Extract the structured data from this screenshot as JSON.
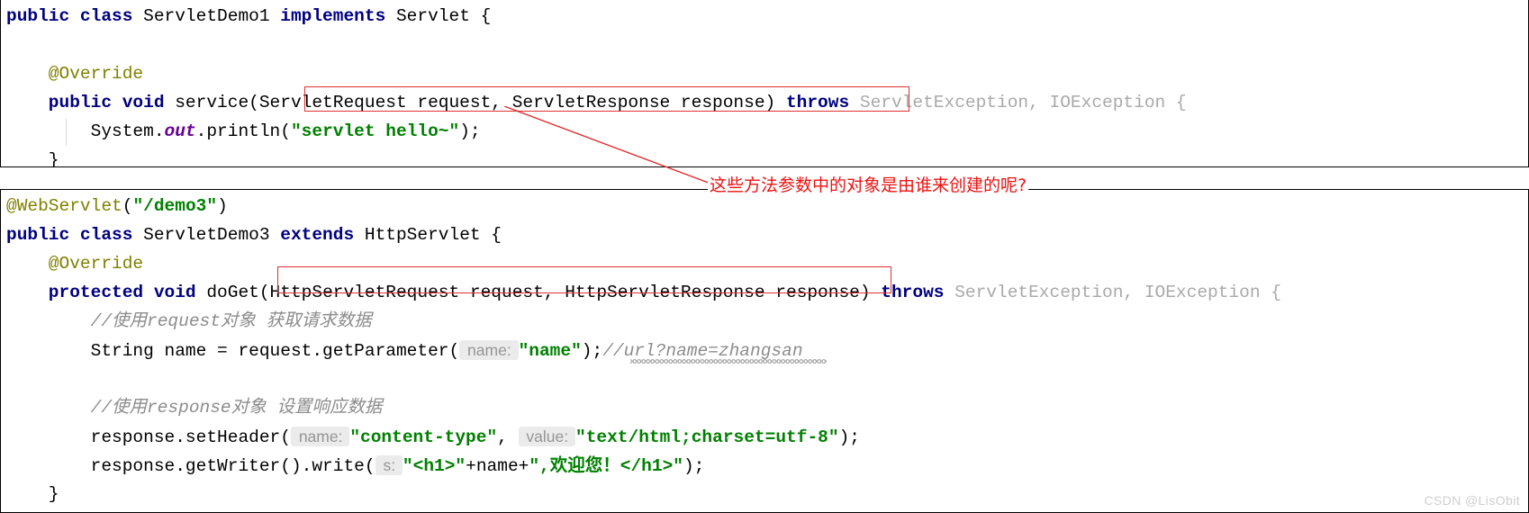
{
  "top_block": {
    "lines": [
      [
        {
          "t": "public class ",
          "c": "kw"
        },
        {
          "t": "ServletDemo1 ",
          "c": "plain"
        },
        {
          "t": "implements ",
          "c": "kw"
        },
        {
          "t": "Servlet {",
          "c": "plain"
        }
      ],
      [],
      [
        {
          "t": "    @Override",
          "c": "anno"
        }
      ],
      [
        {
          "t": "    public void ",
          "c": "kw"
        },
        {
          "t": "service(ServletRequest request, ServletResponse response) ",
          "c": "plain"
        },
        {
          "t": "throws ",
          "c": "kw"
        },
        {
          "t": "ServletException, IOException {",
          "c": "grey"
        }
      ],
      [
        {
          "t": "        System.",
          "c": "plain"
        },
        {
          "t": "out",
          "c": "field"
        },
        {
          "t": ".println(",
          "c": "plain"
        },
        {
          "t": "\"servlet hello~\"",
          "c": "str"
        },
        {
          "t": ");",
          "c": "plain"
        }
      ],
      [
        {
          "t": "    }",
          "c": "plain"
        }
      ]
    ]
  },
  "bottom_block": {
    "lines": [
      [
        {
          "t": "@WebServlet",
          "c": "anno"
        },
        {
          "t": "(",
          "c": "plain"
        },
        {
          "t": "\"/demo3\"",
          "c": "str"
        },
        {
          "t": ")",
          "c": "plain"
        }
      ],
      [
        {
          "t": "public class ",
          "c": "kw"
        },
        {
          "t": "ServletDemo3 ",
          "c": "plain"
        },
        {
          "t": "extends ",
          "c": "kw"
        },
        {
          "t": "HttpServlet {",
          "c": "plain"
        }
      ],
      [
        {
          "t": "    @Override",
          "c": "anno"
        }
      ],
      [
        {
          "t": "    protected void ",
          "c": "kw"
        },
        {
          "t": "doGet(HttpServletRequest request, HttpServletResponse response) ",
          "c": "plain"
        },
        {
          "t": "throws ",
          "c": "kw"
        },
        {
          "t": "ServletException, IOException {",
          "c": "grey"
        }
      ],
      [
        {
          "t": "        //使用request对象 获取请求数据",
          "c": "comment"
        }
      ],
      [
        {
          "t": "        String name = request.getParameter(",
          "c": "plain"
        },
        {
          "t": " name: ",
          "c": "hint"
        },
        {
          "t": "\"name\"",
          "c": "str"
        },
        {
          "t": ");",
          "c": "plain"
        },
        {
          "t": "//url?name=zhangsan",
          "c": "comment"
        }
      ],
      [],
      [
        {
          "t": "        //使用response对象 设置响应数据",
          "c": "comment"
        }
      ],
      [
        {
          "t": "        response.setHeader(",
          "c": "plain"
        },
        {
          "t": " name: ",
          "c": "hint"
        },
        {
          "t": "\"content-type\"",
          "c": "str"
        },
        {
          "t": ", ",
          "c": "plain"
        },
        {
          "t": " value: ",
          "c": "hint"
        },
        {
          "t": "\"text/html;charset=utf-8\"",
          "c": "str"
        },
        {
          "t": ");",
          "c": "plain"
        }
      ],
      [
        {
          "t": "        response.getWriter().write(",
          "c": "plain"
        },
        {
          "t": " s: ",
          "c": "hint"
        },
        {
          "t": "\"<h1>\"",
          "c": "str"
        },
        {
          "t": "+name+",
          "c": "plain"
        },
        {
          "t": "\",欢迎您！</h1>\"",
          "c": "str"
        },
        {
          "t": ");",
          "c": "plain"
        }
      ],
      [
        {
          "t": "    }",
          "c": "plain"
        }
      ]
    ]
  },
  "annotation": {
    "text": "这些方法参数中的对象是由谁来创建的呢?",
    "color": "#ee1111"
  },
  "highlights": {
    "top_param_label": "ServletRequest request, ServletResponse response",
    "bottom_param_label": "HttpServletRequest request, HttpServletResponse response",
    "color": "#e03030"
  },
  "watermark": {
    "text": "CSDN @LisObit"
  },
  "theme": {
    "keyword_color": "#000080",
    "string_color": "#008000",
    "annotation_color": "#808000",
    "comment_color": "#8c8c8c",
    "muted_type_color": "#a9a9a9",
    "field_color": "#660099",
    "hint_bg": "#ebebeb",
    "hint_fg": "#959595",
    "background": "#ffffff"
  }
}
